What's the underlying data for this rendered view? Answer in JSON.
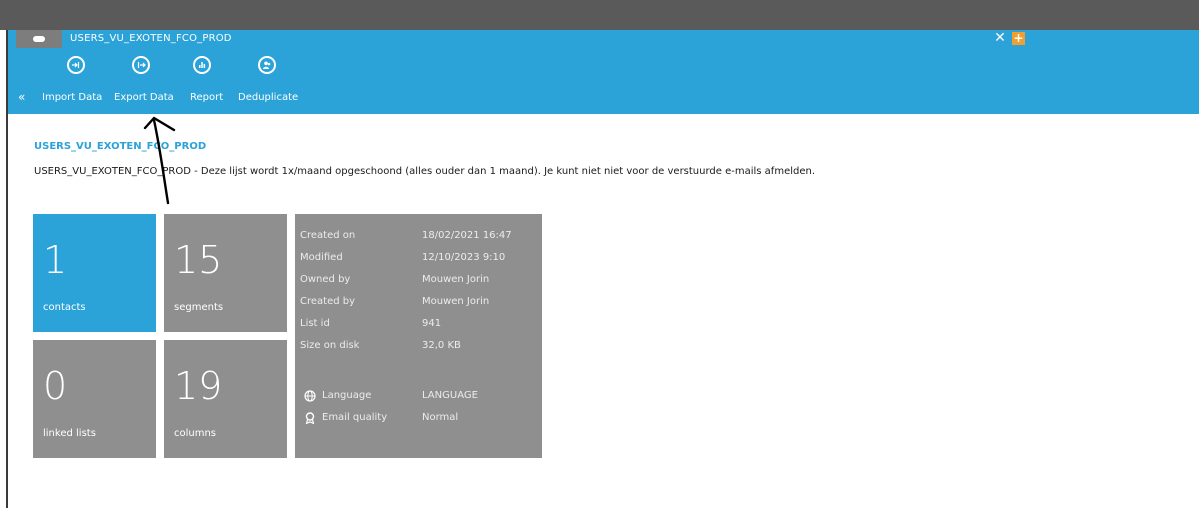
{
  "tab": {
    "title": "USERS_VU_EXOTEN_FCO_PROD",
    "close_glyph": "✕",
    "add_glyph": "+"
  },
  "toolbar": {
    "collapse_glyph": "«",
    "buttons": [
      {
        "label": "Import Data",
        "icon": "import-icon"
      },
      {
        "label": "Export Data",
        "icon": "export-icon"
      },
      {
        "label": "Report",
        "icon": "report-icon"
      },
      {
        "label": "Deduplicate",
        "icon": "deduplicate-icon"
      }
    ]
  },
  "list": {
    "title": "USERS_VU_EXOTEN_FCO_PROD",
    "description": "USERS_VU_EXOTEN_FCO_PROD - Deze lijst wordt 1x/maand opgeschoond (alles ouder dan 1 maand). Je kunt niet niet voor de verstuurde e-mails afmelden."
  },
  "stats": {
    "contacts": {
      "value": "1",
      "label": "contacts"
    },
    "segments": {
      "value": "15",
      "label": "segments"
    },
    "linked_lists": {
      "value": "0",
      "label": "linked lists"
    },
    "columns": {
      "value": "19",
      "label": "columns"
    }
  },
  "info": {
    "created_on": {
      "label": "Created on",
      "value": "18/02/2021 16:47"
    },
    "modified": {
      "label": "Modified",
      "value": "12/10/2023 9:10"
    },
    "owned_by": {
      "label": "Owned by",
      "value": "Mouwen Jorin"
    },
    "created_by": {
      "label": "Created by",
      "value": "Mouwen Jorin"
    },
    "list_id": {
      "label": "List id",
      "value": "941"
    },
    "size_on_disk": {
      "label": "Size on disk",
      "value": "32,0 KB"
    },
    "language": {
      "label": "Language",
      "value": "LANGUAGE",
      "icon": "globe-icon"
    },
    "email_quality": {
      "label": "Email quality",
      "value": "Normal",
      "icon": "award-icon"
    }
  },
  "colors": {
    "accent": "#2ba3d8",
    "tile_gray": "#8f8f8f",
    "tab_add": "#f0a030",
    "topbar": "#5a5a5a"
  }
}
